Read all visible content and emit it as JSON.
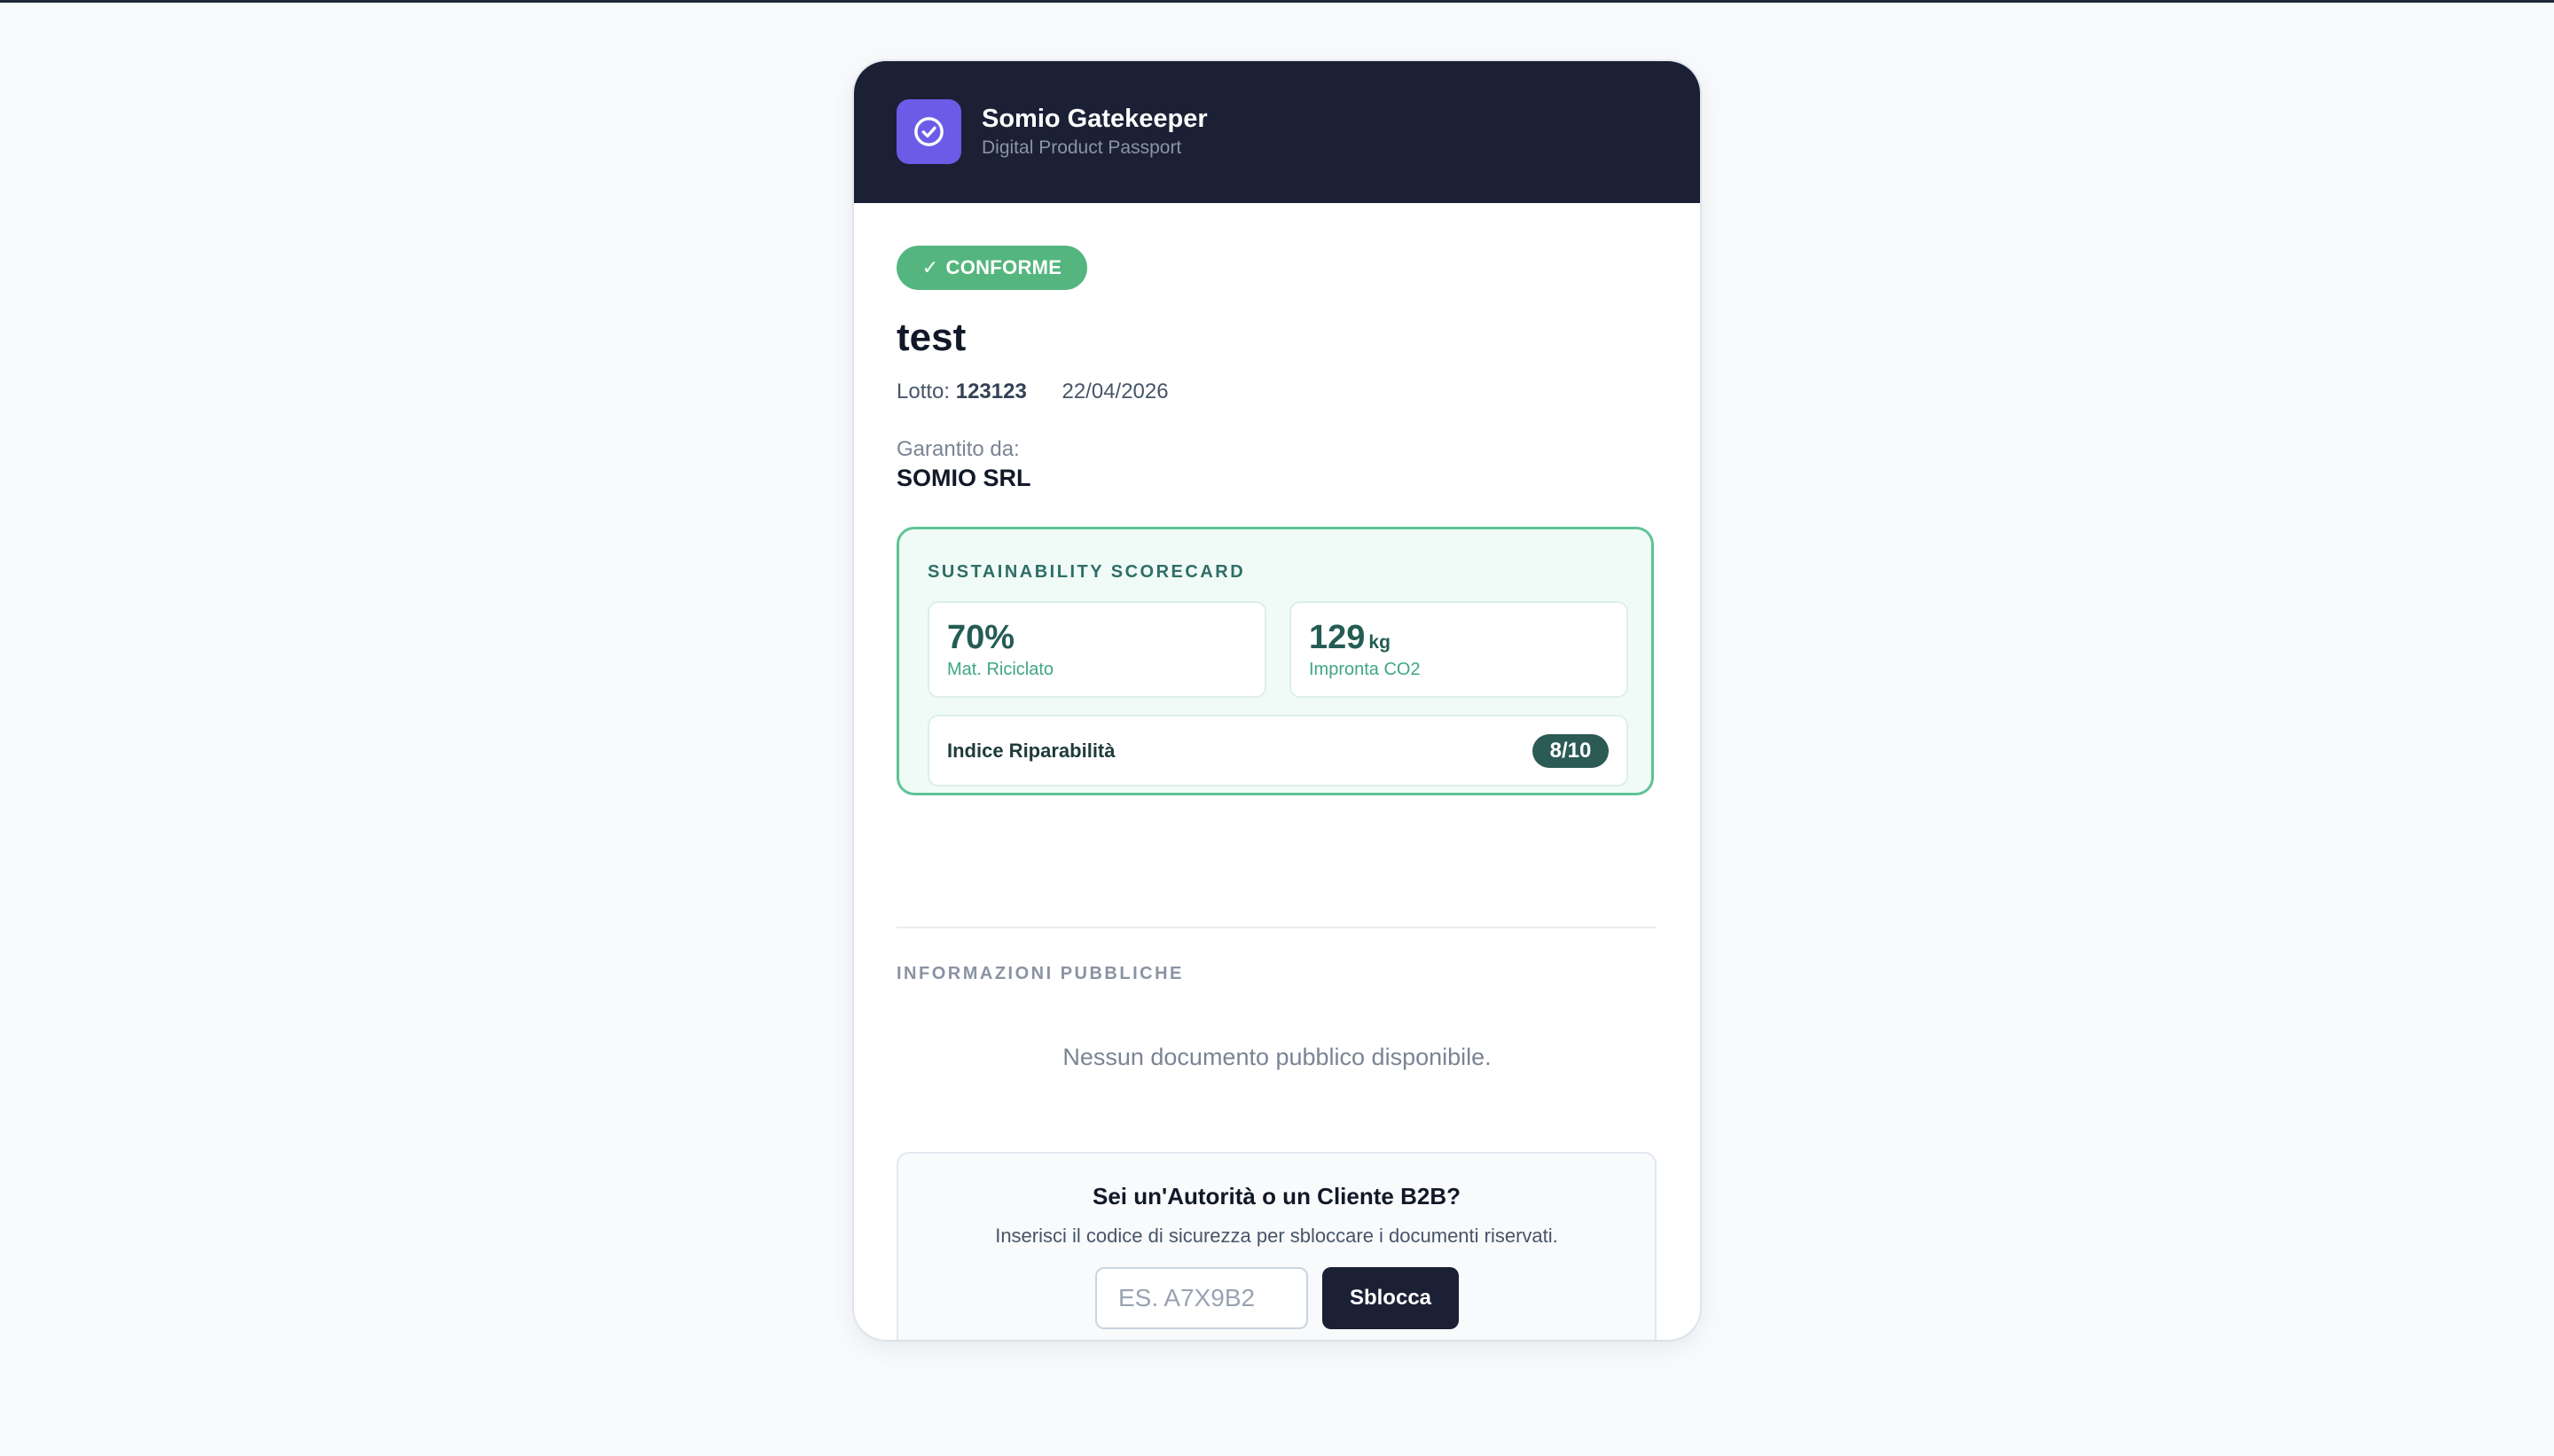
{
  "header": {
    "title": "Somio Gatekeeper",
    "subtitle": "Digital Product Passport",
    "logo_icon": "check-circle-icon",
    "background": "#1b2035",
    "logo_color": "#6b5ce7"
  },
  "status": {
    "icon": "✓",
    "label": "CONFORME",
    "color": "#54b67e"
  },
  "product": {
    "name": "test",
    "lot_label": "Lotto:",
    "lot_value": "123123",
    "date": "22/04/2026"
  },
  "guarantor": {
    "label": "Garantito da:",
    "name": "SOMIO SRL"
  },
  "scorecard": {
    "title": "SUSTAINABILITY SCORECARD",
    "recycled": {
      "value": "70%",
      "label": "Mat. Riciclato"
    },
    "co2": {
      "value": "129",
      "unit": "kg",
      "label": "Impronta CO2"
    },
    "repairability": {
      "label": "Indice Riparabilità",
      "score": "8/10"
    },
    "accent": "#5fc396"
  },
  "public_info": {
    "title": "INFORMAZIONI PUBBLICHE",
    "empty_message": "Nessun documento pubblico disponibile."
  },
  "unlock": {
    "title": "Sei un'Autorità o un Cliente B2B?",
    "description": "Inserisci il codice di sicurezza per sbloccare i documenti riservati.",
    "input_placeholder": "ES. A7X9B2",
    "input_value": "",
    "button_label": "Sblocca"
  }
}
